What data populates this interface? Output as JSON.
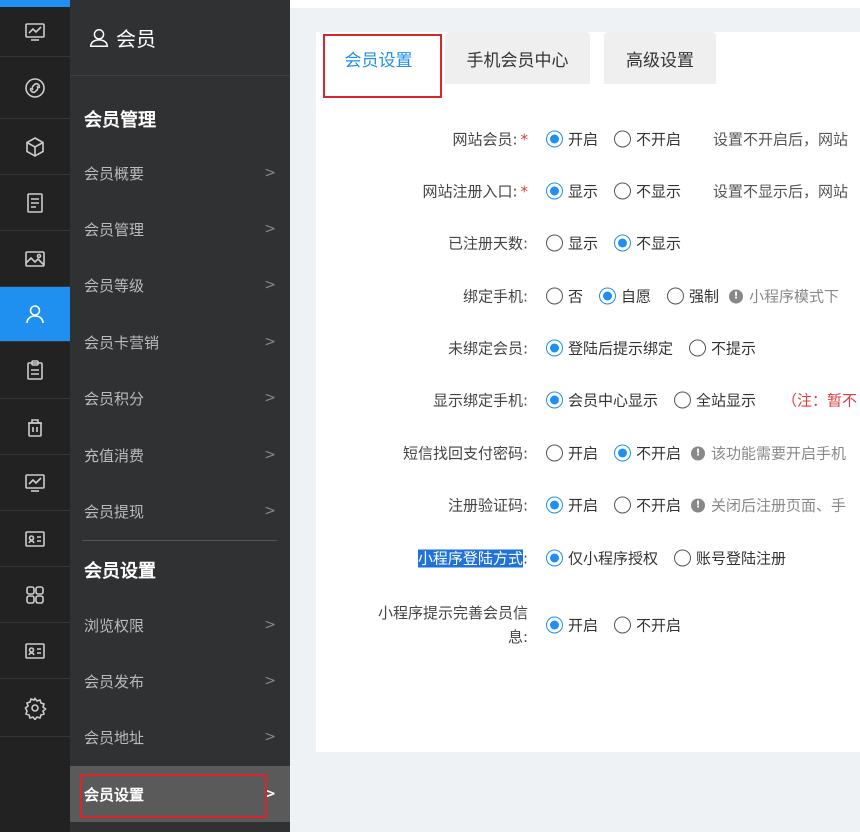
{
  "sidebar": {
    "title": "会员",
    "groups": [
      {
        "title": "会员管理",
        "items": [
          "会员概要",
          "会员管理",
          "会员等级",
          "会员卡营销",
          "会员积分",
          "充值消费",
          "会员提现"
        ]
      },
      {
        "title": "会员设置",
        "items": [
          "浏览权限",
          "会员发布",
          "会员地址",
          "会员设置"
        ]
      }
    ],
    "active_item": "会员设置"
  },
  "tabs": [
    "会员设置",
    "手机会员中心",
    "高级设置"
  ],
  "form": {
    "rows": [
      {
        "label": "网站会员:",
        "required": true,
        "options": [
          "开启",
          "不开启"
        ],
        "selected": 0,
        "hint": "设置不开启后，网站"
      },
      {
        "label": "网站注册入口:",
        "required": true,
        "options": [
          "显示",
          "不显示"
        ],
        "selected": 0,
        "hint": "设置不显示后，网站"
      },
      {
        "label": "已注册天数:",
        "options": [
          "显示",
          "不显示"
        ],
        "selected": 1
      },
      {
        "label": "绑定手机:",
        "options": [
          "否",
          "自愿",
          "强制"
        ],
        "selected": 1,
        "tip": "小程序模式下"
      },
      {
        "label": "未绑定会员:",
        "options": [
          "登陆后提示绑定",
          "不提示"
        ],
        "selected": 0
      },
      {
        "label": "显示绑定手机:",
        "options": [
          "会员中心显示",
          "全站显示"
        ],
        "selected": 0,
        "note": "（注：暂不"
      },
      {
        "label": "短信找回支付密码:",
        "options": [
          "开启",
          "不开启"
        ],
        "selected": 1,
        "tip": "该功能需要开启手机"
      },
      {
        "label": "注册验证码:",
        "options": [
          "开启",
          "不开启"
        ],
        "selected": 0,
        "tip": "关闭后注册页面、手"
      },
      {
        "label_selected": "小程序登陆方式",
        "label_suffix": ":",
        "options": [
          "仅小程序授权",
          "账号登陆注册"
        ],
        "selected": 0
      },
      {
        "label": "小程序提示完善会员信息:",
        "options": [
          "开启",
          "不开启"
        ],
        "selected": 0
      }
    ]
  },
  "icons": [
    "chart-icon",
    "link-icon",
    "cube-icon",
    "document-icon",
    "image-icon",
    "user-icon",
    "clipboard-icon",
    "trash-icon",
    "chart-icon",
    "id-card-icon",
    "grid-icon",
    "id-card-icon",
    "gear-icon"
  ],
  "colors": {
    "accent": "#1f8ff0",
    "required": "#e03c3c",
    "highlight_box": "#d9262c"
  }
}
